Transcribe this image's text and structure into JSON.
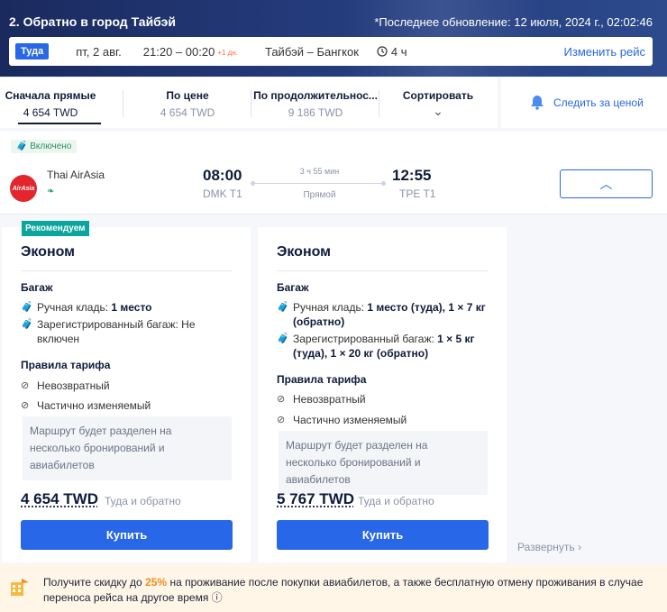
{
  "header": {
    "title": "2. Обратно в город Тайбэй",
    "last_update": "*Последнее обновление: 12 июля, 2024 г., 02:02:46"
  },
  "route": {
    "direction": "Туда",
    "date": "пт, 2 авг.",
    "time": "21:20 – 00:20",
    "plus_day": "+1 дн.",
    "cities": "Тайбэй – Бангкок",
    "duration": "4 ч",
    "change_label": "Изменить рейс"
  },
  "sort": {
    "tabs": [
      {
        "title": "Сначала прямые",
        "value": "4 654 TWD"
      },
      {
        "title": "По цене",
        "value": "4 654 TWD"
      },
      {
        "title": "По продолжительнос...",
        "value": "9 186 TWD"
      },
      {
        "title": "Сортировать",
        "value": ""
      }
    ],
    "track_label": "Следить за ценой"
  },
  "flight": {
    "included": "Включено",
    "airline": "Thai AirAsia",
    "logo_text": "AirAsia",
    "dep_time": "08:00",
    "dep_airport": "DMK T1",
    "duration": "3 ч 55 мин",
    "direct": "Прямой",
    "arr_time": "12:55",
    "arr_airport": "TPE T1"
  },
  "fares": [
    {
      "badge": "Рекомендуем",
      "title": "Эконом",
      "baggage_heading": "Багаж",
      "carry_on_label": "Ручная кладь:",
      "carry_on_value": "1 место",
      "checked_label": "Зарегистрированный багаж:",
      "checked_value": "Не включен",
      "rules_heading": "Правила тарифа",
      "refund": "Невозвратный",
      "change": "Частично изменяемый",
      "note": "Маршрут будет разделен на несколько бронирований и авиабилетов",
      "price": "4 654 TWD",
      "price_sub": "Туда и обратно",
      "buy": "Купить"
    },
    {
      "title": "Эконом",
      "baggage_heading": "Багаж",
      "carry_on_label": "Ручная кладь:",
      "carry_on_value": "1 место (туда), 1 × 7 кг (обратно)",
      "checked_label": "Зарегистрированный багаж:",
      "checked_value": "1 × 5 кг (туда), 1 × 20 кг (обратно)",
      "rules_heading": "Правила тарифа",
      "refund": "Невозвратный",
      "change": "Частично изменяемый",
      "note": "Маршрут будет разделен на несколько бронирований и авиабилетов",
      "price": "5 767 TWD",
      "price_sub": "Туда и обратно",
      "buy": "Купить"
    }
  ],
  "expand_label": "Развернуть",
  "promo": {
    "text_before": "Получите скидку до",
    "percent": "25%",
    "text_after": "на проживание после покупки авиабилетов, а также бесплатную отмену проживания в случае переноса рейса на другое время"
  },
  "colors": {
    "accent": "#2867e8",
    "header": "#1a2a5e",
    "recommended": "#0aa59c",
    "promo_bg": "#fff6e8",
    "promo_accent": "#f08c1a"
  }
}
